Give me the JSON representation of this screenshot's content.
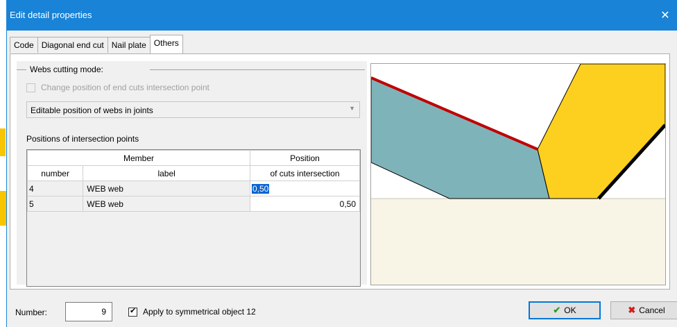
{
  "window": {
    "title": "Edit detail properties",
    "close_glyph": "✕"
  },
  "tabs": [
    {
      "label": "Code",
      "active": false
    },
    {
      "label": "Diagonal end cut",
      "active": false
    },
    {
      "label": "Nail plate",
      "active": false
    },
    {
      "label": "Others",
      "active": true
    }
  ],
  "webs": {
    "legend": "Webs cutting mode:",
    "checkbox_label": "Change position of end cuts intersection point",
    "checkbox_checked": false,
    "checkbox_enabled": false,
    "select_value": "Editable position of webs in joints"
  },
  "positions": {
    "label": "Positions of intersection points",
    "header": {
      "member": "Member",
      "position": "Position",
      "number": "number",
      "label_col": "label",
      "cuts": "of cuts intersection"
    },
    "rows": [
      {
        "number": "4",
        "label": "WEB web",
        "position": "0,50"
      },
      {
        "number": "5",
        "label": "WEB web",
        "position": "0,50"
      }
    ]
  },
  "preview": {
    "colors": {
      "web": "#7fb3ba",
      "member": "#fdd020",
      "ground": "#f8f5e6",
      "cut_line": "#c00000",
      "edge": "#000000"
    }
  },
  "footer": {
    "number_label": "Number:",
    "number_value": "9",
    "apply_label": "Apply to symmetrical object 12",
    "apply_checked": true,
    "ok_label": "OK",
    "cancel_label": "Cancel"
  }
}
